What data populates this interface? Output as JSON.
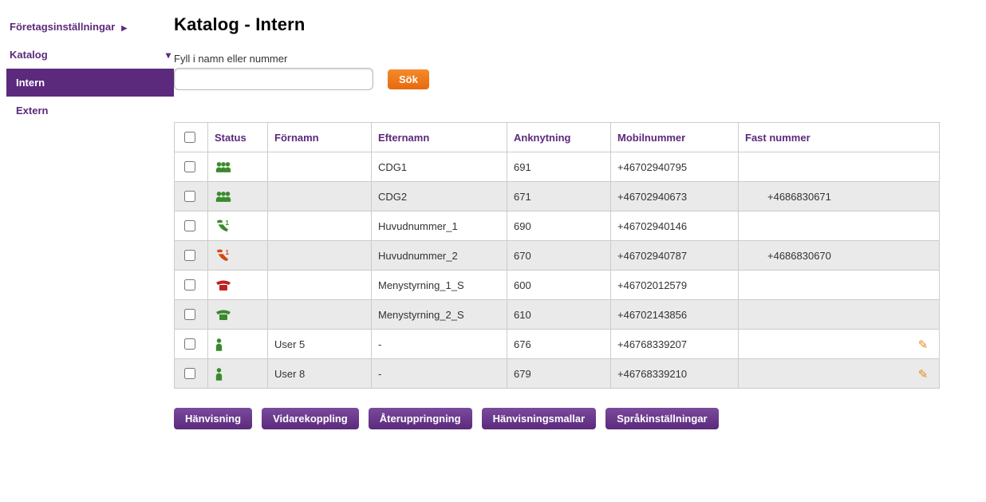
{
  "sidebar": {
    "top": "Företagsinställningar",
    "group": "Katalog",
    "items": [
      {
        "label": "Intern",
        "active": true
      },
      {
        "label": "Extern",
        "active": false
      }
    ]
  },
  "page_title": "Katalog - Intern",
  "search": {
    "label": "Fyll i namn eller nummer",
    "value": "",
    "button": "Sök"
  },
  "table": {
    "headers": {
      "status": "Status",
      "first": "Förnamn",
      "last": "Efternamn",
      "ext": "Anknytning",
      "mob": "Mobilnummer",
      "fixed": "Fast nummer"
    },
    "rows": [
      {
        "status_icon": "group-green",
        "first": "",
        "last": "CDG1",
        "ext": "691",
        "mob": "+46702940795",
        "fixed": "",
        "editable": false
      },
      {
        "status_icon": "group-green",
        "first": "",
        "last": "CDG2",
        "ext": "671",
        "mob": "+46702940673",
        "fixed": "+4686830671",
        "editable": false
      },
      {
        "status_icon": "phone1-green",
        "first": "",
        "last": "Huvudnummer_1",
        "ext": "690",
        "mob": "+46702940146",
        "fixed": "",
        "editable": false
      },
      {
        "status_icon": "phone1-orange",
        "first": "",
        "last": "Huvudnummer_2",
        "ext": "670",
        "mob": "+46702940787",
        "fixed": "+4686830670",
        "editable": false
      },
      {
        "status_icon": "desk-red",
        "first": "",
        "last": "Menystyrning_1_S",
        "ext": "600",
        "mob": "+46702012579",
        "fixed": "",
        "editable": false
      },
      {
        "status_icon": "desk-green",
        "first": "",
        "last": "Menystyrning_2_S",
        "ext": "610",
        "mob": "+46702143856",
        "fixed": "",
        "editable": false
      },
      {
        "status_icon": "user-green",
        "first": "User 5",
        "last": "-",
        "ext": "676",
        "mob": "+46768339207",
        "fixed": "",
        "editable": true
      },
      {
        "status_icon": "user-green",
        "first": "User 8",
        "last": "-",
        "ext": "679",
        "mob": "+46768339210",
        "fixed": "",
        "editable": true
      }
    ]
  },
  "actions": [
    "Hänvisning",
    "Vidarekoppling",
    "Återuppringning",
    "Hänvisningsmallar",
    "Språkinställningar"
  ],
  "colors": {
    "purple": "#5b2a7c",
    "orange": "#e76a0f",
    "green": "#3a8a2c",
    "red": "#c02020",
    "iconorange": "#d14a0f"
  }
}
